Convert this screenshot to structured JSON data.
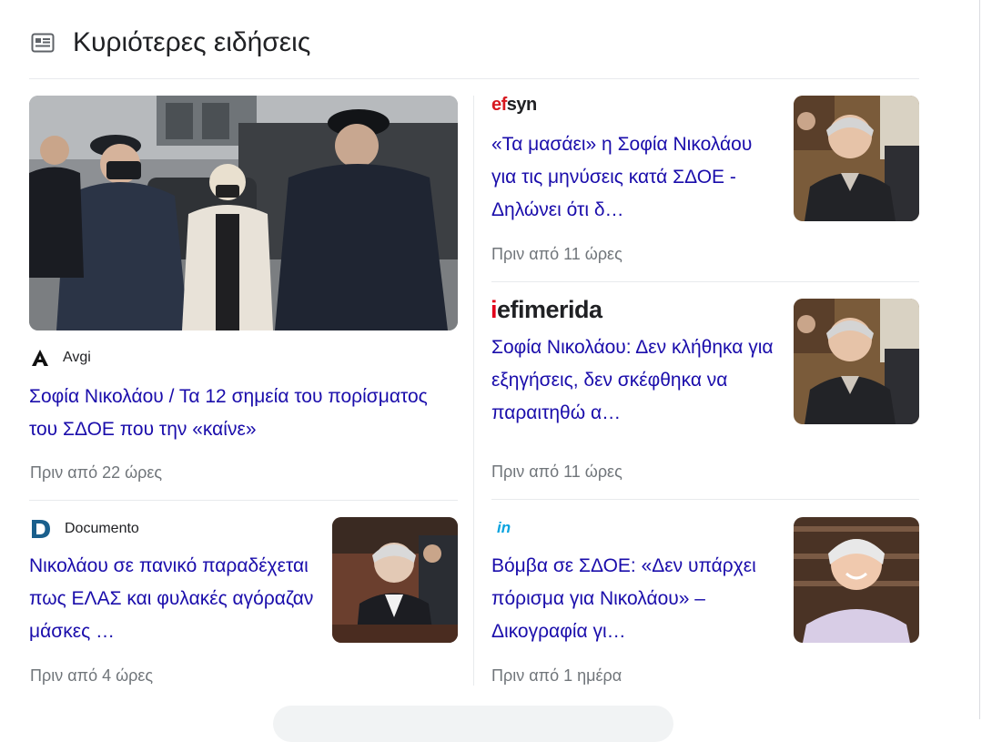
{
  "section": {
    "title": "Κυριότερες ειδήσεις",
    "icon": "news-icon"
  },
  "stories": [
    {
      "source": "Avgi",
      "headline": "Σοφία Νικολάου / Τα 12 σημεία του πορίσματος του ΣΔΟΕ που την «καίνε»",
      "time": "Πριν από 22 ώρες"
    },
    {
      "source": "Documento",
      "headline": "Νικολάου σε πανικό παραδέχεται πως ΕΛΑΣ και φυλακές αγόραζαν μάσκες …",
      "time": "Πριν από 4 ώρες"
    },
    {
      "source": "efsyn",
      "headline": "«Τα μασάει» η Σοφία Νικολάου για τις μηνύσεις κατά ΣΔΟΕ - Δηλώνει ότι δ…",
      "time": "Πριν από 11 ώρες"
    },
    {
      "source": "iefimerida",
      "headline": "Σοφία Νικολάου: Δεν κλήθηκα για εξηγήσεις, δεν σκέφθηκα να παραιτηθώ α…",
      "time": "Πριν από 11 ώρες"
    },
    {
      "source": "in",
      "headline": "Βόμβα σε ΣΔΟΕ: «Δεν υπάρχει πόρισμα για Νικολάου» – Δικογραφία γι…",
      "time": "Πριν από 1 ημέρα"
    }
  ],
  "colors": {
    "link": "#1a0dab",
    "meta": "#70757a",
    "divider": "#e8eaed",
    "efsyn_red": "#d71920",
    "iefimerida_red": "#e2001a",
    "in_blue": "#0aa3df",
    "documento_blue": "#1a5f8c"
  }
}
